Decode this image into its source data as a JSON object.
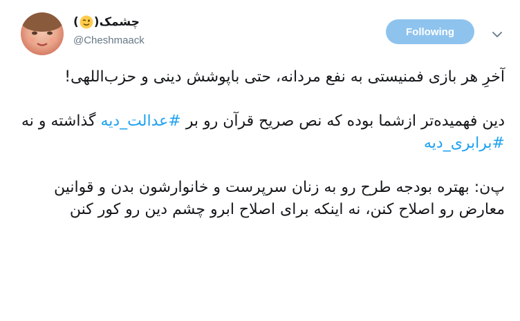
{
  "profile": {
    "name_text": "چشمک",
    "name_paren_open": "(",
    "name_paren_close": ")",
    "emoji_icon": "winking-face-emoji",
    "handle": "@Cheshmaack"
  },
  "actions": {
    "follow_label": "Following",
    "caret_icon": "chevron-down-icon"
  },
  "tweet": {
    "p1": "آخرِ هر بازی فمنیستی به نفع مردانه، حتی باپوشش دینی و حزب‌اللهی!",
    "p2_prefix": "دین فهمیده‌تر ازشما بوده که نص صریح قرآن رو بر ",
    "hashtag1": "#عدالت_دیه",
    "p2_middle": " گذاشته و نه ",
    "hashtag2": "#برابری_دیه",
    "p3": "پ‌ن: بهتره بودجه طرح رو به زنان سرپرست و خانوارشون بدن و قوانین معارض رو اصلاح کنن، نه اینکه برای اصلاح ابرو چشم دین رو کور کنن"
  },
  "colors": {
    "link": "#1da1f2",
    "follow_bg": "#8ec3ee",
    "secondary_text": "#657786",
    "primary_text": "#14171a"
  }
}
